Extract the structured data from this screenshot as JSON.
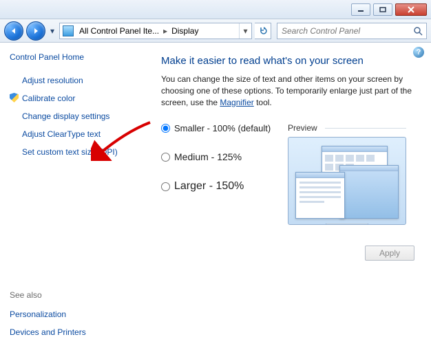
{
  "window": {
    "min_tip": "Minimize",
    "max_tip": "Maximize",
    "close_tip": "Close"
  },
  "nav": {
    "back_tip": "Back",
    "fwd_tip": "Forward"
  },
  "address": {
    "seg1": "All Control Panel Ite...",
    "seg2": "Display"
  },
  "search": {
    "placeholder": "Search Control Panel"
  },
  "sidebar": {
    "home": "Control Panel Home",
    "links": [
      "Adjust resolution",
      "Calibrate color",
      "Change display settings",
      "Adjust ClearType text",
      "Set custom text size (DPI)"
    ],
    "see_also_hdr": "See also",
    "see_also": [
      "Personalization",
      "Devices and Printers"
    ]
  },
  "content": {
    "title": "Make it easier to read what's on your screen",
    "desc_pre": "You can change the size of text and other items on your screen by choosing one of these options. To temporarily enlarge just part of the screen, use the ",
    "magnifier": "Magnifier",
    "desc_post": " tool.",
    "opt1": "Smaller - 100% (default)",
    "opt2": "Medium - 125%",
    "opt3": "Larger - 150%",
    "preview": "Preview",
    "apply": "Apply"
  }
}
